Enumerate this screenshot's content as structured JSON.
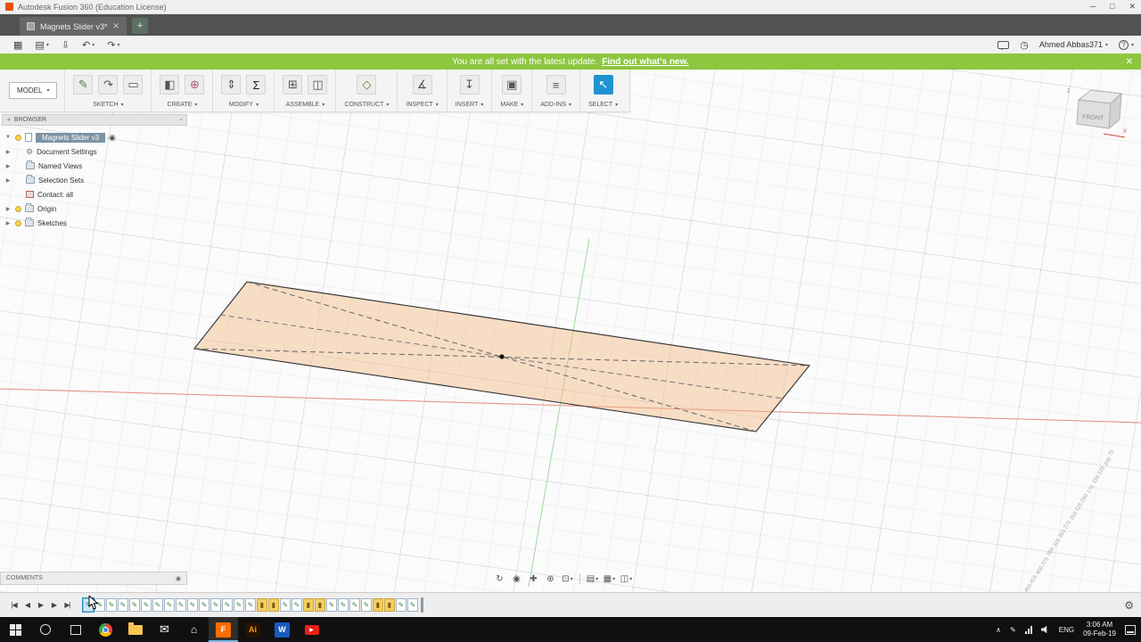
{
  "window": {
    "title": "Autodesk Fusion 360 (Education License)"
  },
  "tabs": {
    "active": "Magnets Slider v3*",
    "add_label": "+"
  },
  "topbar": {
    "user": "Ahmed Abbas371",
    "help": "?"
  },
  "banner": {
    "message": "You are all set with the latest update.",
    "link": "Find out what's new."
  },
  "ribbon": {
    "mode": "MODEL",
    "groups": [
      {
        "label": "SKETCH",
        "icons": [
          {
            "name": "create-sketch-icon",
            "glyph": "✎",
            "color": "#47804a"
          },
          {
            "name": "sketch-arc-icon",
            "glyph": "↷",
            "color": "#555"
          },
          {
            "name": "rectangle-icon",
            "glyph": "▭",
            "color": "#555"
          }
        ]
      },
      {
        "label": "CREATE",
        "icons": [
          {
            "name": "new-body-icon",
            "glyph": "◧",
            "color": "#555"
          },
          {
            "name": "form-sphere-icon",
            "glyph": "⊕",
            "color": "#b0567a"
          }
        ]
      },
      {
        "label": "MODIFY",
        "icons": [
          {
            "name": "press-pull-icon",
            "glyph": "⇕",
            "color": "#555"
          },
          {
            "name": "change-parameters-icon",
            "glyph": "Σ",
            "color": "#222"
          }
        ]
      },
      {
        "label": "ASSEMBLE",
        "icons": [
          {
            "name": "new-component-icon",
            "glyph": "⊞",
            "color": "#555"
          },
          {
            "name": "joint-icon",
            "glyph": "◫",
            "color": "#555"
          }
        ]
      },
      {
        "label": "CONSTRUCT",
        "icons": [
          {
            "name": "construct-plane-icon",
            "glyph": "◇",
            "color": "#6a7d3a"
          }
        ]
      },
      {
        "label": "INSPECT",
        "icons": [
          {
            "name": "measure-icon",
            "glyph": "∡",
            "color": "#555"
          }
        ]
      },
      {
        "label": "INSERT",
        "icons": [
          {
            "name": "insert-icon",
            "glyph": "↧",
            "color": "#555"
          }
        ]
      },
      {
        "label": "MAKE",
        "icons": [
          {
            "name": "make-icon",
            "glyph": "▣",
            "color": "#555"
          }
        ]
      },
      {
        "label": "ADD-INS",
        "icons": [
          {
            "name": "addins-icon",
            "glyph": "≡",
            "color": "#555"
          }
        ]
      },
      {
        "label": "SELECT",
        "icons": [
          {
            "name": "select-cursor-icon",
            "glyph": "↖",
            "color": "#fff",
            "bg": "#1f93d0"
          }
        ]
      }
    ]
  },
  "browser": {
    "header": "BROWSER",
    "root": "Magnets Slider v3",
    "items": [
      {
        "label": "Document Settings",
        "icon": "gear",
        "caret": true,
        "bulb": false
      },
      {
        "label": "Named Views",
        "icon": "folder",
        "caret": true,
        "bulb": false
      },
      {
        "label": "Selection Sets",
        "icon": "folder",
        "caret": true,
        "bulb": false
      },
      {
        "label": "Contact: all",
        "icon": "contact",
        "caret": false,
        "bulb": false
      },
      {
        "label": "Origin",
        "icon": "folder",
        "caret": true,
        "bulb": true
      },
      {
        "label": "Sketches",
        "icon": "folder",
        "caret": true,
        "bulb": true
      }
    ]
  },
  "viewcube": {
    "face": "FRONT",
    "axis_top": "Z",
    "axis_right": "X"
  },
  "ruler": {
    "values": [
      "75",
      "100",
      "125",
      "150",
      "175",
      "200",
      "225",
      "250",
      "275",
      "300",
      "325",
      "350",
      "375",
      "400",
      "425",
      "450"
    ]
  },
  "comments": {
    "label": "COMMENTS"
  },
  "navbar": {
    "icons": [
      {
        "name": "orbit-icon",
        "glyph": "↻",
        "caret": false
      },
      {
        "name": "look-at-icon",
        "glyph": "◉",
        "caret": false
      },
      {
        "name": "pan-icon",
        "glyph": "✚",
        "caret": false
      },
      {
        "name": "zoom-icon",
        "glyph": "⊕",
        "caret": false
      },
      {
        "name": "fit-icon",
        "glyph": "⊡",
        "caret": true
      },
      {
        "sep": true
      },
      {
        "name": "display-settings-icon",
        "glyph": "▤",
        "caret": true
      },
      {
        "name": "grid-settings-icon",
        "glyph": "▦",
        "caret": true
      },
      {
        "name": "viewports-icon",
        "glyph": "◫",
        "caret": true
      }
    ]
  },
  "timeline": {
    "controls": [
      {
        "name": "go-to-start-button",
        "glyph": "|◀"
      },
      {
        "name": "step-back-button",
        "glyph": "◀"
      },
      {
        "name": "play-button",
        "glyph": "▶"
      },
      {
        "name": "step-forward-button",
        "glyph": "▶"
      },
      {
        "name": "go-to-end-button",
        "glyph": "▶|"
      }
    ],
    "items": [
      "sketch",
      "sketch",
      "sketch",
      "sketch",
      "sketch",
      "sketch",
      "sketch",
      "sketch",
      "sketch",
      "sketch",
      "sketch",
      "sketch",
      "sketch",
      "sketch",
      "sketch",
      "feature",
      "feature",
      "sketch",
      "sketch",
      "feature",
      "feature",
      "sketch",
      "sketch",
      "sketch",
      "sketch",
      "feature",
      "feature",
      "sketch",
      "sketch"
    ],
    "selected_index": 0
  },
  "taskbar": {
    "apps": [
      {
        "name": "chrome",
        "style": "chrome"
      },
      {
        "name": "file-explorer",
        "style": "folder"
      },
      {
        "name": "mail",
        "style": "mail"
      },
      {
        "name": "store",
        "style": "store"
      },
      {
        "name": "fusion-360",
        "style": "square",
        "label": "F",
        "bg": "#ff6b00",
        "active": true
      },
      {
        "name": "illustrator",
        "style": "square",
        "label": "Ai",
        "bg": "#261300",
        "color": "#ff9a00"
      },
      {
        "name": "word",
        "style": "square",
        "label": "W",
        "bg": "#185abd"
      },
      {
        "name": "youtube",
        "style": "youtube"
      }
    ],
    "lang": "ENG",
    "time": "3:06 AM",
    "date": "09-Feb-19"
  }
}
